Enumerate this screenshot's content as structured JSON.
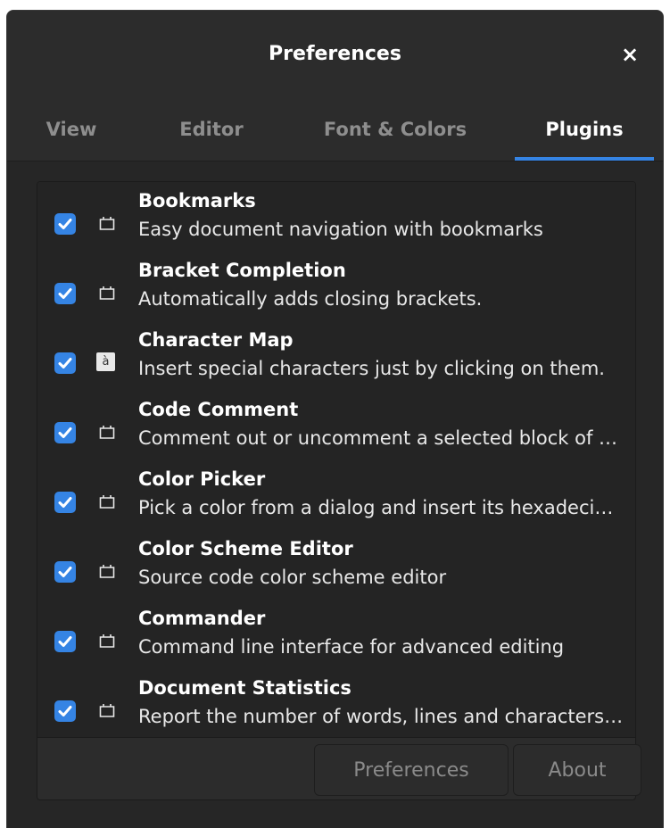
{
  "window": {
    "title": "Preferences",
    "close_symbol": "×"
  },
  "tabs": [
    {
      "label": "View",
      "active": false
    },
    {
      "label": "Editor",
      "active": false
    },
    {
      "label": "Font & Colors",
      "active": false
    },
    {
      "label": "Plugins",
      "active": true
    }
  ],
  "plugins": [
    {
      "name": "Bookmarks",
      "description": "Easy document navigation with bookmarks",
      "checked": true,
      "icon": "plugin-icon"
    },
    {
      "name": "Bracket Completion",
      "description": "Automatically adds closing brackets.",
      "checked": true,
      "icon": "plugin-icon"
    },
    {
      "name": "Character Map",
      "description": "Insert special characters just by clicking on them.",
      "checked": true,
      "icon": "character-map-icon",
      "icon_glyph": "à"
    },
    {
      "name": "Code Comment",
      "description": "Comment out or uncomment a selected block of code.",
      "checked": true,
      "icon": "plugin-icon"
    },
    {
      "name": "Color Picker",
      "description": "Pick a color from a dialog and insert its hexadecimal representation.",
      "checked": true,
      "icon": "plugin-icon"
    },
    {
      "name": "Color Scheme Editor",
      "description": "Source code color scheme editor",
      "checked": true,
      "icon": "plugin-icon"
    },
    {
      "name": "Commander",
      "description": "Command line interface for advanced editing",
      "checked": true,
      "icon": "plugin-icon"
    },
    {
      "name": "Document Statistics",
      "description": "Report the number of words, lines and characters in a document.",
      "checked": true,
      "icon": "plugin-icon"
    }
  ],
  "buttons": {
    "preferences_label": "Preferences",
    "about_label": "About"
  },
  "colors": {
    "accent": "#3584e4",
    "background": "#242424",
    "header": "#2c2c2c"
  }
}
